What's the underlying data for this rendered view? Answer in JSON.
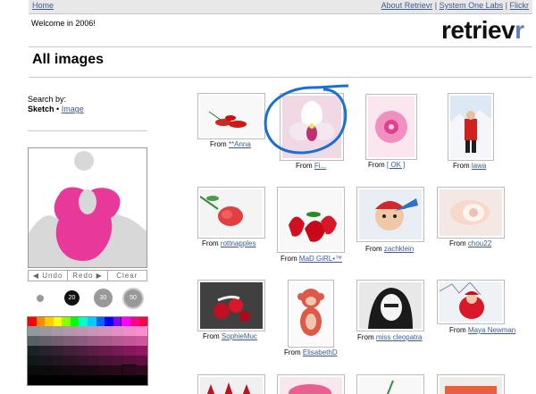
{
  "topbar": {
    "home": "Home",
    "about": "About Retrievr",
    "sep1": "|",
    "system_one": "System One Labs",
    "sep2": "|",
    "flickr": "Flickr"
  },
  "header": {
    "welcome": "Welcome in 2006!",
    "logo_main": "retriev",
    "logo_accent": "r"
  },
  "page": {
    "title": "All images"
  },
  "search": {
    "prefix": "Search by:",
    "sketch": "Sketch",
    "dot": "•",
    "image": "Image"
  },
  "tools": {
    "undo": "◀ Undo",
    "redo": "Redo ▶",
    "clear": "Clear"
  },
  "brushes": [
    "",
    "20",
    "30",
    "50"
  ],
  "colors": {
    "accent": "#5f7fb6",
    "link": "#3a5a9a",
    "sketch_pink": "#e8399a"
  },
  "results": [
    {
      "prefix": "From",
      "user": "**Anna"
    },
    {
      "prefix": "From",
      "user": "Fi..."
    },
    {
      "prefix": "From",
      "user": "[ OK ]"
    },
    {
      "prefix": "From",
      "user": "lawa"
    },
    {
      "prefix": "From",
      "user": "rottnapples"
    },
    {
      "prefix": "From",
      "user": "MaD GiRL•™"
    },
    {
      "prefix": "From",
      "user": "zachklein"
    },
    {
      "prefix": "From",
      "user": "chou22"
    },
    {
      "prefix": "From",
      "user": "SophieMuc"
    },
    {
      "prefix": "From",
      "user": "ElisabethD"
    },
    {
      "prefix": "From",
      "user": "miss cleopatra"
    },
    {
      "prefix": "From",
      "user": "Maya Newman"
    }
  ]
}
